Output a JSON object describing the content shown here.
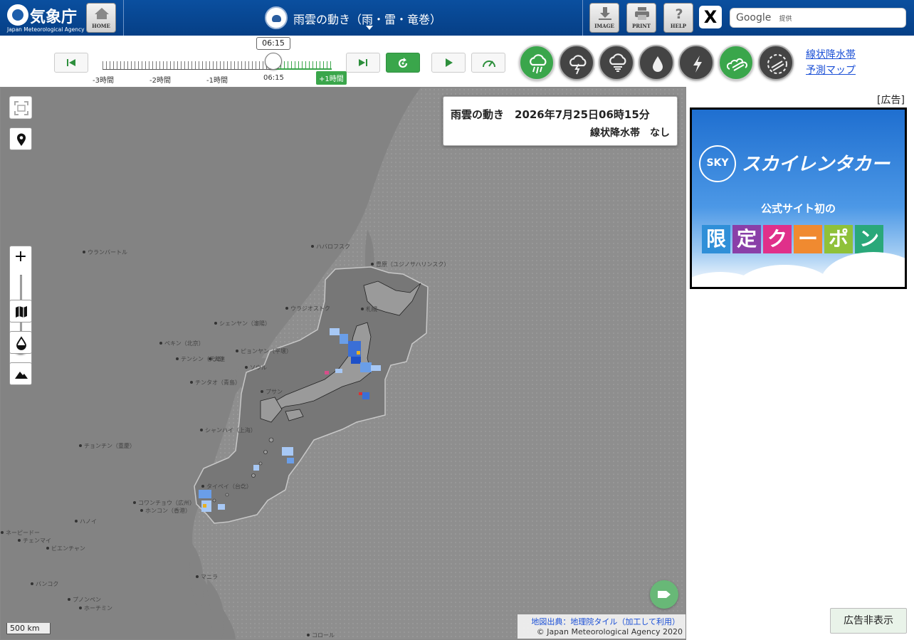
{
  "header": {
    "logo_text": "気象庁",
    "logo_sub": "Japan Meteorological Agency",
    "home_label": "HOME",
    "title": "雨雲の動き（雨・雷・竜巻）",
    "buttons": [
      {
        "label": "IMAGE",
        "icon": "download-icon"
      },
      {
        "label": "PRINT",
        "icon": "printer-icon"
      },
      {
        "label": "HELP",
        "icon": "question-icon"
      }
    ],
    "x_label": "X",
    "search": {
      "google": "Google",
      "provided": "提供"
    }
  },
  "toolbar": {
    "current_time": "06:15",
    "tick_labels": [
      "-3時間",
      "-2時間",
      "-1時間",
      "06:15"
    ],
    "plus_label": "+1時間",
    "links": [
      "線状降水帯",
      "予測マップ"
    ],
    "layers": [
      "rain-cloud",
      "thunder",
      "tornado",
      "rain-drop",
      "lightning",
      "linear-rainband",
      "linear-rainband-forecast"
    ],
    "accent_green": "#3aa64b"
  },
  "map": {
    "info_line1": "雨雲の動き　2026年7月25日06時15分",
    "info_line2": "線状降水帯　なし",
    "cities": [
      "ウランバートル",
      "ハバロフスク",
      "豊原（ユジノサハリンスク）",
      "ウラジオストク",
      "シェンヤン（瀋陽）",
      "ペキン（北京）",
      "ピョンヤン（平壌）",
      "テンシン（天津）",
      "大連",
      "ソウル",
      "チンタオ（青島）",
      "プサン",
      "シャンハイ（上海）",
      "チョンチン（重慶）",
      "タイペイ（台北）",
      "コワンチョウ（広州）",
      "ホンコン（香港）",
      "ハノイ",
      "ネーピードー",
      "チェンマイ",
      "ビエンチャン",
      "マニラ",
      "バンコク",
      "プノンペン",
      "ホーチミン",
      "札幌",
      "コロール"
    ],
    "scale": "500 km",
    "attribution_1": "地図出典：地理院タイル（加工して利用）",
    "attribution_2": "© Japan Meteorological Agency 2020"
  },
  "ad": {
    "label": "[広告]",
    "logo": "SKY",
    "brand": "スカイレンタカー",
    "subtitle": "公式サイト初の",
    "chars": [
      "限",
      "定",
      "ク",
      "ー",
      "ポ",
      "ン"
    ],
    "char_colors": [
      "#2f8fd8",
      "#8a3fa8",
      "#e0308a",
      "#f08a30",
      "#8fc13a",
      "#2aa87a"
    ],
    "hide_label": "広告非表示"
  }
}
